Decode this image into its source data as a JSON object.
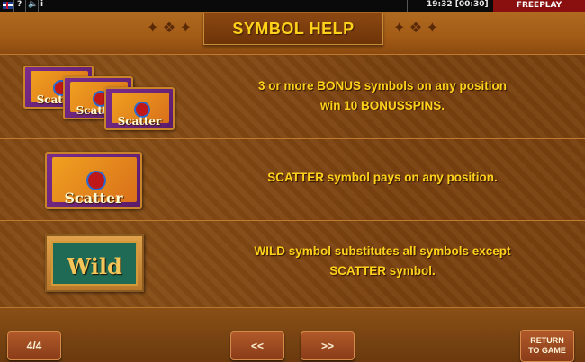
{
  "topbar": {
    "help_label": "?",
    "speaker_glyph": "🔈",
    "info_label": "i",
    "clock": "19:32 [00:30]",
    "mode": "FREEPLAY"
  },
  "header": {
    "title": "SYMBOL HELP"
  },
  "rows": [
    {
      "line1": "3 or more BONUS symbols on any position",
      "line2": "win 10 BONUSSPINS."
    },
    {
      "line1": "SCATTER symbol pays on any position.",
      "line2": ""
    },
    {
      "line1": "WILD symbol substitutes all symbols except",
      "line2": "SCATTER symbol."
    }
  ],
  "symbols": {
    "scatter_label": "Scatter",
    "wild_label": "Wild"
  },
  "footer": {
    "page_indicator": "4/4",
    "prev_label": "<<",
    "next_label": ">>",
    "return_line1": "RETURN",
    "return_line2": "TO GAME"
  },
  "colors": {
    "accent_text": "#ffd21a",
    "freeplay_bg": "#8a1010"
  }
}
